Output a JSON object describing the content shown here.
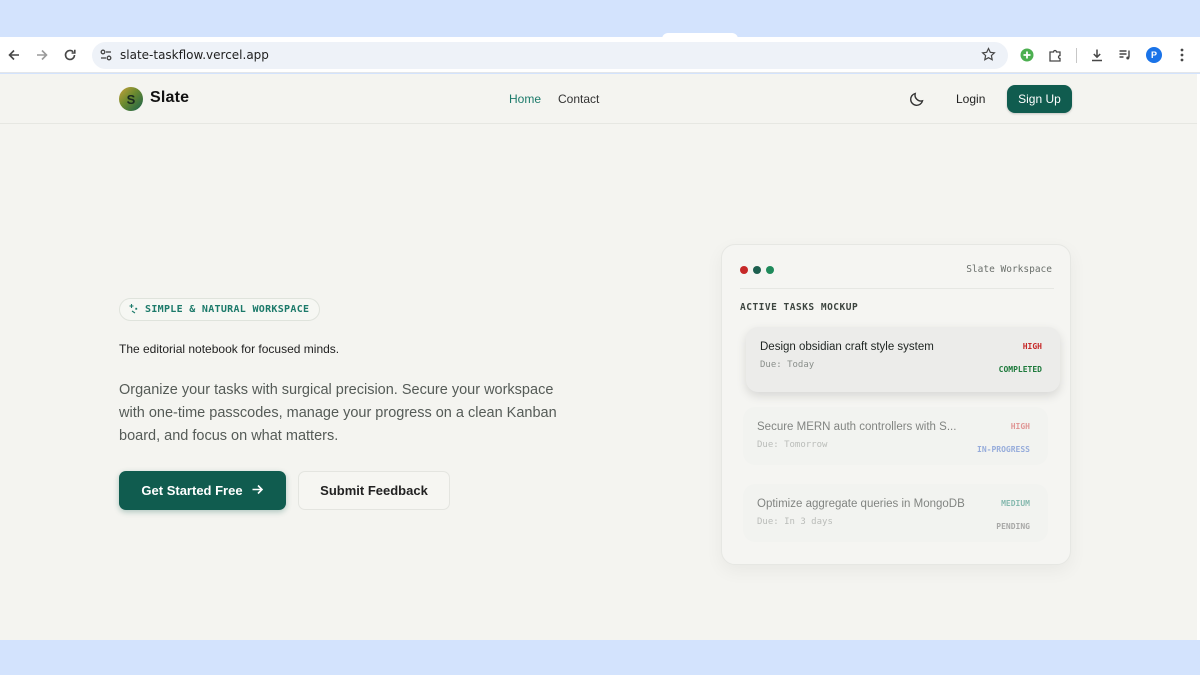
{
  "browser": {
    "url": "slate-taskflow.vercel.app",
    "avatar_initial": "P"
  },
  "navbar": {
    "logo_initial": "S",
    "brand": "Slate",
    "links": [
      "Home",
      "Contact"
    ],
    "active_link": "Home",
    "login": "Login",
    "signup": "Sign Up"
  },
  "hero": {
    "badge": "SIMPLE & NATURAL WORKSPACE",
    "tagline": "The editorial notebook for focused minds.",
    "description": "Organize your tasks with surgical precision. Secure your workspace with one-time passcodes, manage your progress on a clean Kanban board, and focus on what matters.",
    "primary_cta": "Get Started Free",
    "secondary_cta": "Submit Feedback"
  },
  "mockup": {
    "workspace_label": "Slate Workspace",
    "section_title": "ACTIVE TASKS MOCKUP",
    "window_dots": [
      "#c62828",
      "#1d5f4f",
      "#1f8a5b"
    ],
    "tasks": [
      {
        "title": "Design obsidian craft style system",
        "due": "Due: Today",
        "priority": "HIGH",
        "status": "COMPLETED",
        "priority_color": "#c62828",
        "status_color": "#1e7a3c"
      },
      {
        "title": "Secure MERN auth controllers with S...",
        "due": "Due: Tomorrow",
        "priority": "HIGH",
        "status": "IN-PROGRESS",
        "priority_color": "#d04a4a",
        "status_color": "#4a72c9"
      },
      {
        "title": "Optimize aggregate queries in MongoDB",
        "due": "Due: In 3 days",
        "priority": "MEDIUM",
        "status": "PENDING",
        "priority_color": "#2f8a7a",
        "status_color": "#6b6b6b"
      }
    ]
  },
  "colors": {
    "brand": "#105c4f",
    "accent": "#1c7a6a",
    "page_bg": "#f4f4f0"
  }
}
